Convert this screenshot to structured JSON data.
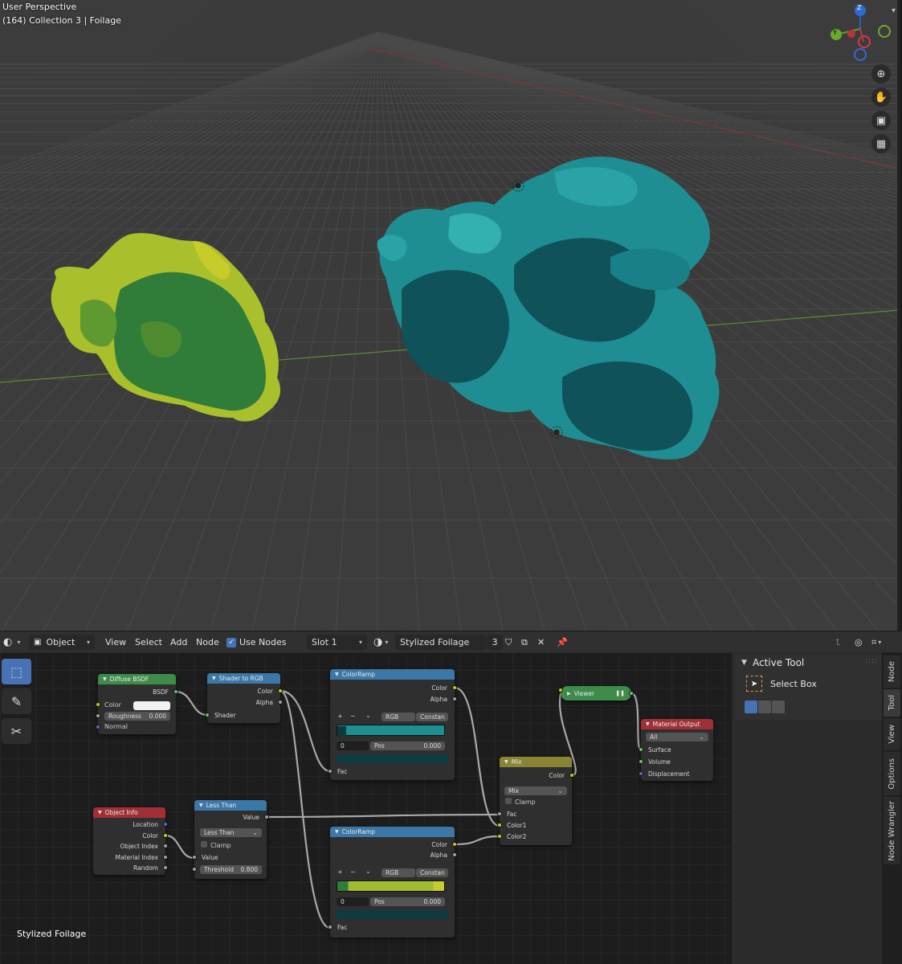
{
  "viewport": {
    "title": "User Perspective",
    "subtitle": "(164) Collection 3 | Foilage",
    "gizmo": {
      "z": "Z",
      "y": "Y"
    },
    "nav_icons": [
      "zoom-icon",
      "hand-pan-icon",
      "camera-icon",
      "grid-projection-icon"
    ]
  },
  "header": {
    "editor_type_icon": "shader-editor-icon",
    "mode": "Object",
    "menus": [
      "View",
      "Select",
      "Add",
      "Node"
    ],
    "use_nodes_label": "Use Nodes",
    "slot": "Slot 1",
    "material_name": "Stylized Foilage",
    "user_count": "3"
  },
  "canvas": {
    "material_label": "Stylized Foilage"
  },
  "nodes": {
    "diffuse": {
      "title": "Diffuse BSDF",
      "out": "BSDF",
      "color": "Color",
      "roughness": "Roughness",
      "roughness_val": "0.000",
      "normal": "Normal"
    },
    "shader_rgb": {
      "title": "Shader to RGB",
      "color": "Color",
      "alpha": "Alpha",
      "shader": "Shader"
    },
    "ramp1": {
      "title": "ColorRamp",
      "color": "Color",
      "alpha": "Alpha",
      "mode": "RGB",
      "interp": "Constan",
      "index": "0",
      "pos_label": "Pos",
      "pos_val": "0.000",
      "fac": "Fac",
      "plus": "+",
      "minus": "−",
      "chev": "⌄"
    },
    "object_info": {
      "title": "Object Info",
      "location": "Location",
      "color": "Color",
      "object_index": "Object Index",
      "material_index": "Material Index",
      "random": "Random"
    },
    "less_than": {
      "title": "Less Than",
      "value_out": "Value",
      "op": "Less Than",
      "clamp": "Clamp",
      "value_in": "Value",
      "threshold": "Threshold",
      "threshold_val": "0.800"
    },
    "ramp2": {
      "title": "ColorRamp",
      "color": "Color",
      "alpha": "Alpha",
      "mode": "RGB",
      "interp": "Constan",
      "index": "0",
      "pos_label": "Pos",
      "pos_val": "0.000",
      "fac": "Fac",
      "plus": "+",
      "minus": "−",
      "chev": "⌄"
    },
    "mix": {
      "title": "Mix",
      "color": "Color",
      "blend": "Mix",
      "clamp": "Clamp",
      "fac": "Fac",
      "color1": "Color1",
      "color2": "Color2"
    },
    "viewer": {
      "title": "Viewer"
    },
    "output": {
      "title": "Material Output",
      "target": "All",
      "surface": "Surface",
      "volume": "Volume",
      "displacement": "Displacement"
    }
  },
  "sidebar": {
    "panel_title": "Active Tool",
    "tool_name": "Select Box",
    "tabs": [
      "Node",
      "Tool",
      "View",
      "Options",
      "Node Wrangler"
    ],
    "active_tab": "Tool"
  },
  "colors": {
    "teal_foliage": "#1f8e92",
    "green_foliage": "#9fbb2e",
    "accent": "#4772b3"
  }
}
